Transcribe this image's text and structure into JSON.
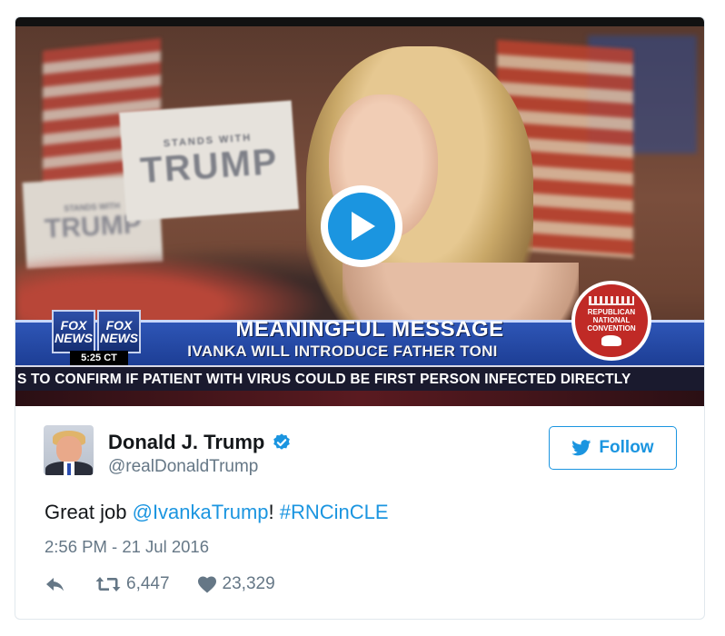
{
  "video": {
    "background_signs": {
      "big_sign_small_line": "STANDS WITH",
      "big_sign_big_word": "TRUMP",
      "small_sign_small_line": "STANDS WITH",
      "small_sign_big_word": "TRUMP"
    },
    "network_logo": [
      "FOX NEWS",
      "FOX NEWS"
    ],
    "time_badge": "5:25 CT",
    "headline": "MEANINGFUL MESSAGE",
    "subheadline": "IVANKA WILL INTRODUCE FATHER TONI",
    "seal_text": "REPUBLICAN NATIONAL CONVENTION",
    "ticker": "S TO CONFIRM IF PATIENT WITH VIRUS COULD BE FIRST PERSON INFECTED DIRECTLY",
    "play_icon": "play-icon"
  },
  "author": {
    "display_name": "Donald J. Trump",
    "handle": "@realDonaldTrump",
    "verified": true,
    "verified_icon": "verified-badge-icon"
  },
  "follow_button": {
    "label": "Follow",
    "icon": "twitter-bird-icon"
  },
  "tweet": {
    "text_prefix": "Great job ",
    "mention": "@IvankaTrump",
    "text_middle": "! ",
    "hashtag": "#RNCinCLE",
    "timestamp": "2:56 PM - 21 Jul 2016"
  },
  "actions": {
    "reply_icon": "reply-icon",
    "retweet_icon": "retweet-icon",
    "retweet_count": "6,447",
    "like_icon": "heart-icon",
    "like_count": "23,329"
  },
  "colors": {
    "accent": "#1b95e0",
    "text": "#14171a",
    "muted": "#657786",
    "border": "#e1e8ed"
  }
}
